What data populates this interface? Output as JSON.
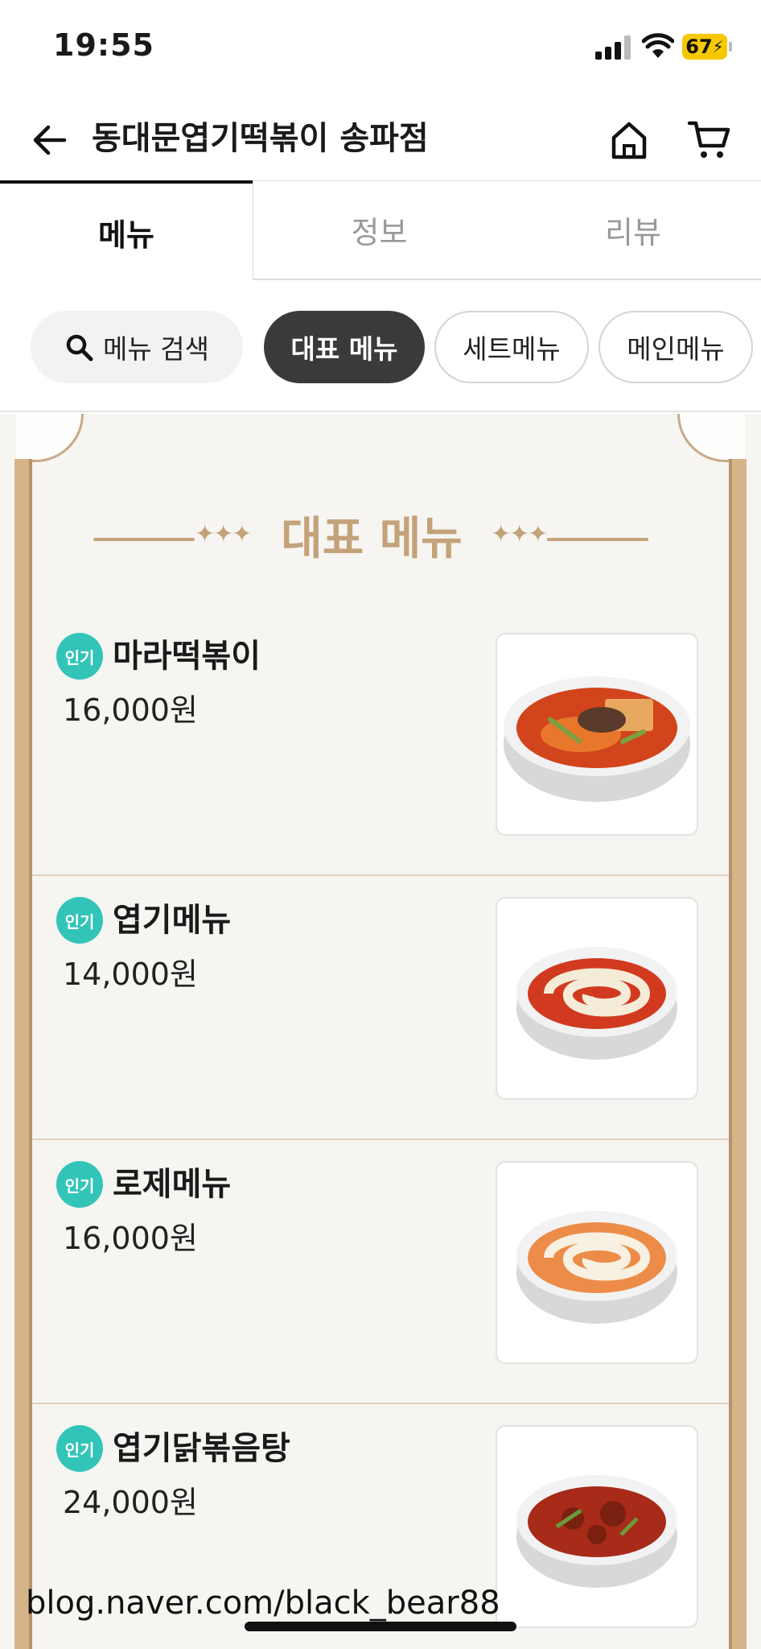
{
  "status_bar": {
    "time": "19:55",
    "battery": "67"
  },
  "header": {
    "title": "동대문엽기떡볶이 송파점",
    "back_icon": "arrow-left-icon",
    "home_icon": "home-icon",
    "cart_icon": "cart-icon"
  },
  "tabs": [
    {
      "label": "메뉴",
      "active": true
    },
    {
      "label": "정보",
      "active": false
    },
    {
      "label": "리뷰",
      "active": false
    }
  ],
  "chips": {
    "search_label": "메뉴 검색",
    "items": [
      "대표 메뉴",
      "세트메뉴",
      "메인메뉴"
    ],
    "selected": "대표 메뉴"
  },
  "section": {
    "title": "대표 메뉴"
  },
  "badge_label": "인기",
  "menu_items": [
    {
      "name": "마라떡볶이",
      "price": "16,000원",
      "badge": "인기"
    },
    {
      "name": "엽기메뉴",
      "price": "14,000원",
      "badge": "인기"
    },
    {
      "name": "로제메뉴",
      "price": "16,000원",
      "badge": "인기"
    },
    {
      "name": "엽기닭볶음탕",
      "price": "24,000원",
      "badge": "인기"
    }
  ],
  "watermark": "blog.naver.com/black_bear88",
  "colors": {
    "accent_gold": "#c4a27a",
    "badge_teal": "#33c4b8",
    "chip_selected": "#3a3a3a",
    "battery": "#f5c800"
  }
}
